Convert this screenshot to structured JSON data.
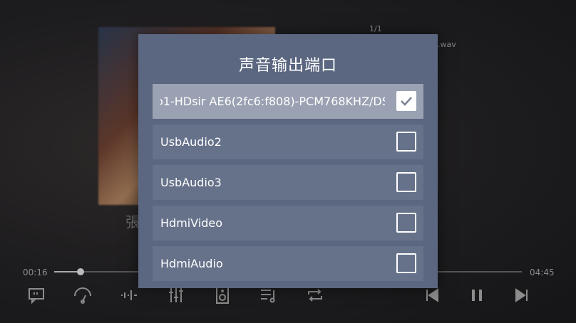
{
  "player": {
    "track_index": "1/1",
    "file_ext": ".wav",
    "song_title": "張",
    "elapsed": "00:16",
    "duration": "04:45",
    "progress": 0.056
  },
  "controls": [
    {
      "name": "lyrics-icon"
    },
    {
      "name": "speed-gauge-icon"
    },
    {
      "name": "waveform-icon"
    },
    {
      "name": "equalizer-icon"
    },
    {
      "name": "speaker-icon"
    },
    {
      "name": "playlist-icon"
    },
    {
      "name": "repeat-icon"
    },
    {
      "name": "previous-icon"
    },
    {
      "name": "pause-icon"
    },
    {
      "name": "next-icon"
    }
  ],
  "dialog": {
    "title": "声音输出端口",
    "options": [
      {
        "label": "o1-HDsir AE6(2fc6:f808)-PCM768KHZ/DS",
        "checked": true
      },
      {
        "label": "UsbAudio2",
        "checked": false
      },
      {
        "label": "UsbAudio3",
        "checked": false
      },
      {
        "label": "HdmiVideo",
        "checked": false
      },
      {
        "label": "HdmiAudio",
        "checked": false
      }
    ]
  },
  "colors": {
    "dialog_bg": "#5b6780",
    "option_bg": "#66728a",
    "option_selected_bg": "#99a1b2",
    "check_color": "#7b8396"
  }
}
